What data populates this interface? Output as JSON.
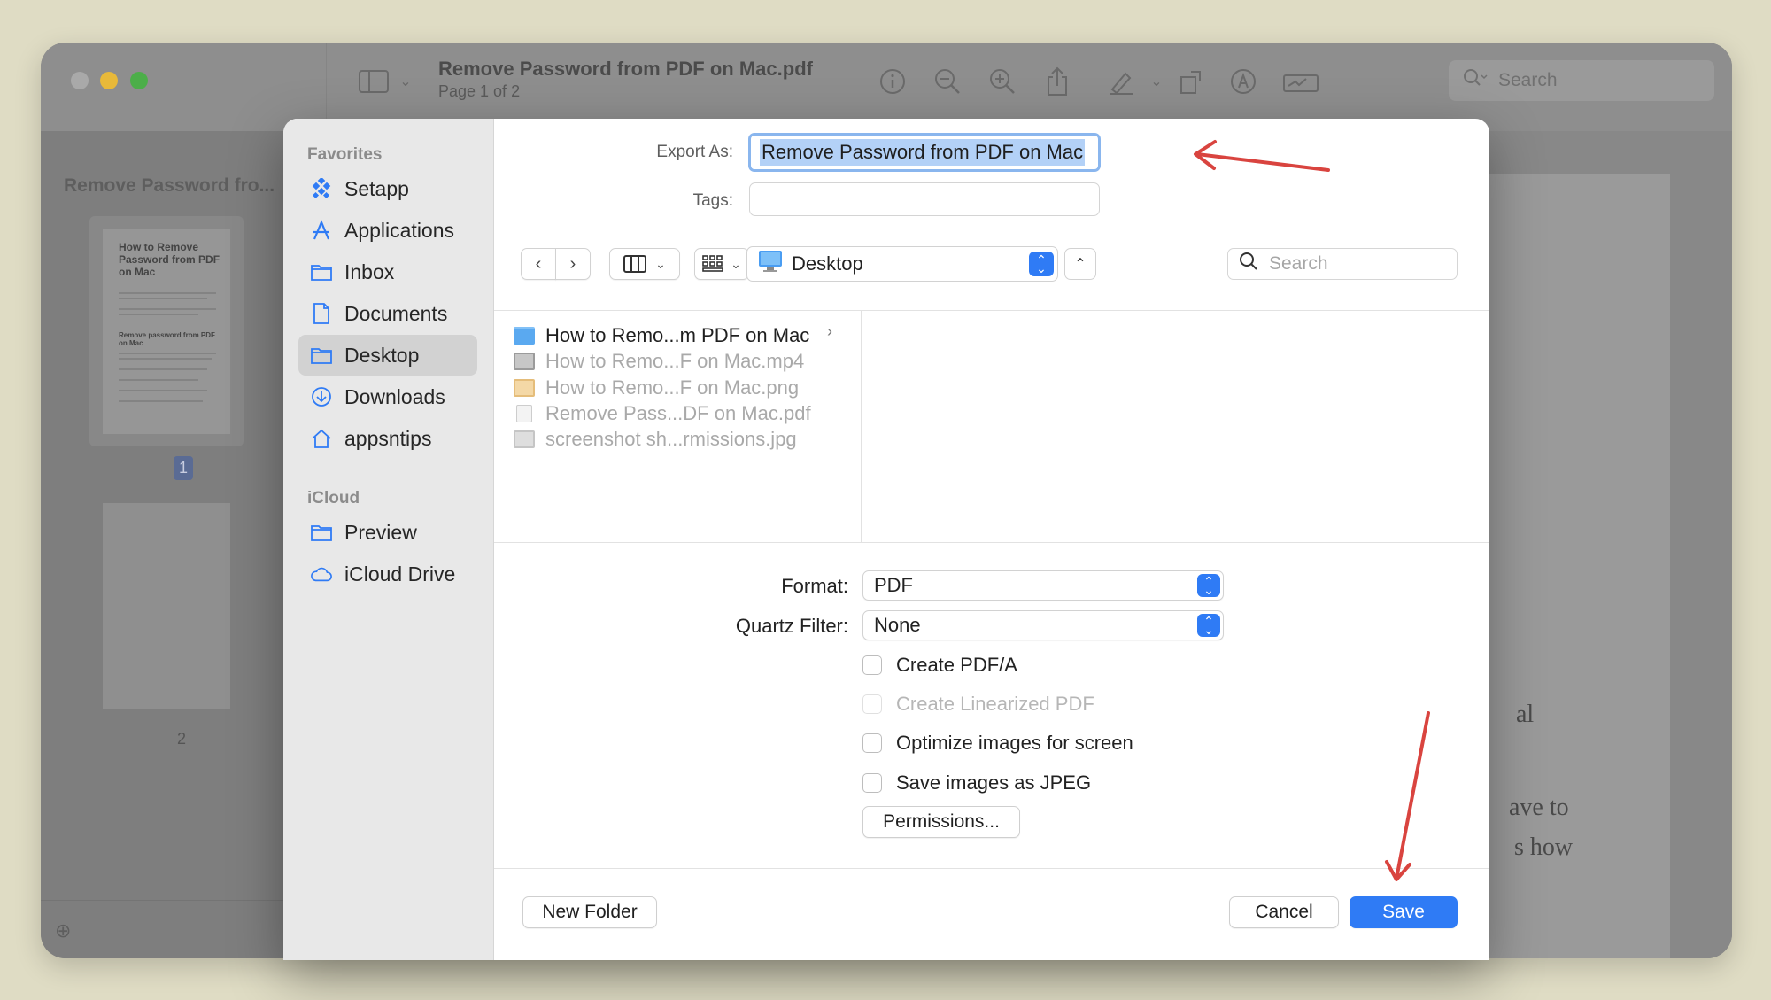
{
  "window": {
    "doc_title": "Remove Password from PDF on Mac.pdf",
    "doc_subtitle": "Page 1 of 2",
    "search_placeholder": "Search"
  },
  "thumbnails": {
    "sidebar_title": "Remove Password fro...",
    "page1_heading": "How to Remove Password from PDF on Mac",
    "page1_subheading": "Remove password from PDF on Mac",
    "page1_number": "1",
    "page2_number": "2"
  },
  "document_fragments": [
    "al",
    "ave to",
    "s how"
  ],
  "dialog": {
    "sidebar": {
      "favorites_label": "Favorites",
      "favorites": [
        {
          "label": "Setapp",
          "icon": "setapp-icon"
        },
        {
          "label": "Applications",
          "icon": "applications-icon"
        },
        {
          "label": "Inbox",
          "icon": "folder-icon"
        },
        {
          "label": "Documents",
          "icon": "document-icon"
        },
        {
          "label": "Desktop",
          "icon": "folder-icon",
          "selected": true
        },
        {
          "label": "Downloads",
          "icon": "download-icon"
        },
        {
          "label": "appsntips",
          "icon": "home-icon"
        }
      ],
      "icloud_label": "iCloud",
      "icloud": [
        {
          "label": "Preview",
          "icon": "folder-icon"
        },
        {
          "label": "iCloud Drive",
          "icon": "cloud-icon"
        }
      ]
    },
    "export_as_label": "Export As:",
    "export_as_value": "Remove Password from PDF on Mac",
    "tags_label": "Tags:",
    "location": "Desktop",
    "search_placeholder": "Search",
    "files": [
      {
        "name": "How to Remo...m PDF on Mac",
        "type": "folder",
        "active": true
      },
      {
        "name": "How to Remo...F on Mac.mp4",
        "type": "video"
      },
      {
        "name": "How to Remo...F on Mac.png",
        "type": "image"
      },
      {
        "name": "Remove Pass...DF on Mac.pdf",
        "type": "pdf"
      },
      {
        "name": "screenshot sh...rmissions.jpg",
        "type": "image"
      }
    ],
    "format_label": "Format:",
    "format_value": "PDF",
    "quartz_label": "Quartz Filter:",
    "quartz_value": "None",
    "options": [
      {
        "label": "Create PDF/A",
        "enabled": true
      },
      {
        "label": "Create Linearized PDF",
        "enabled": false
      },
      {
        "label": "Optimize images for screen",
        "enabled": true
      },
      {
        "label": "Save images as JPEG",
        "enabled": true
      }
    ],
    "permissions_button": "Permissions...",
    "new_folder_button": "New Folder",
    "cancel_button": "Cancel",
    "save_button": "Save"
  },
  "colors": {
    "accent": "#2f7bf5",
    "annotation": "#d9443f",
    "selection": "#b3d1f7"
  }
}
